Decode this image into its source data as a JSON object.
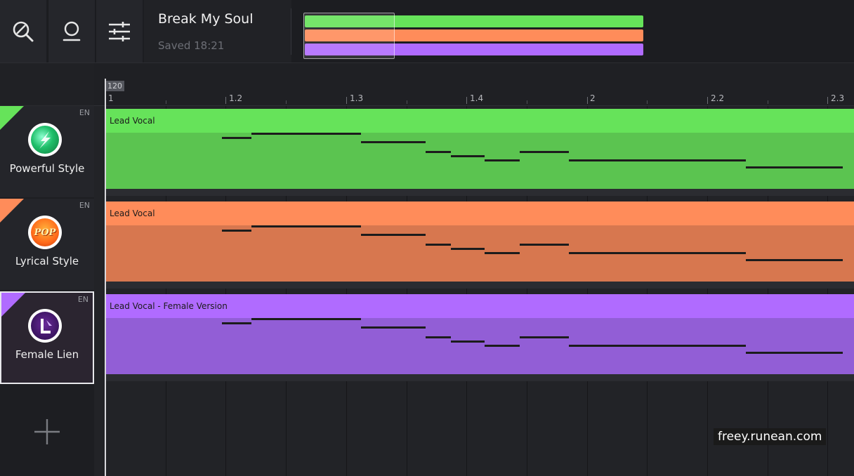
{
  "toolbar": {
    "icons": [
      "search-icon",
      "profile-icon",
      "settings-sliders-icon"
    ]
  },
  "song": {
    "title": "Break My Soul",
    "saved": "Saved 18:21"
  },
  "ruler": {
    "tempo": "120",
    "markers": [
      "1",
      "1.2",
      "1.3",
      "1.4",
      "2",
      "2.2",
      "2.3"
    ]
  },
  "tracks": [
    {
      "name": "Powerful Style",
      "lang": "EN",
      "lane_label": "Lead Vocal",
      "color": "#66e35a",
      "body_color": "#5bc450",
      "avatar_icon": "powerful-style-avatar-icon",
      "selected": false
    },
    {
      "name": "Lyrical Style",
      "lang": "EN",
      "lane_label": "Lead Vocal",
      "color": "#ff8c5a",
      "body_color": "#d7774f",
      "avatar_icon": "pop-avatar-icon",
      "avatar_text": "POP",
      "selected": false
    },
    {
      "name": "Female Lien",
      "lang": "EN",
      "lane_label": "Lead Vocal - Female Version",
      "color": "#b06bff",
      "body_color": "#925ed6",
      "avatar_icon": "female-lien-avatar-icon",
      "selected": true
    }
  ],
  "add_track_icon": "plus-icon",
  "watermark": "freey.runean.com"
}
